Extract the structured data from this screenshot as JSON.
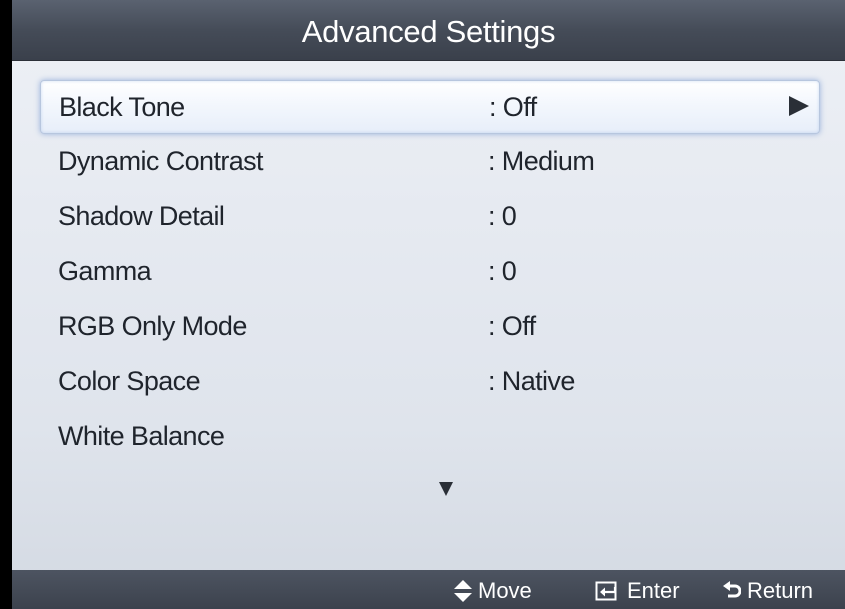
{
  "title": "Advanced Settings",
  "menu_items": [
    {
      "label": "Black Tone",
      "value": ": Off"
    },
    {
      "label": "Dynamic Contrast",
      "value": ": Medium"
    },
    {
      "label": "Shadow Detail",
      "value": ": 0"
    },
    {
      "label": "Gamma",
      "value": ": 0"
    },
    {
      "label": "RGB Only Mode",
      "value": ": Off"
    },
    {
      "label": "Color Space",
      "value": ": Native"
    },
    {
      "label": "White Balance",
      "value": ""
    }
  ],
  "selected_index": 0,
  "footer": {
    "move_label": "Move",
    "enter_label": "Enter",
    "return_label": "Return"
  },
  "icons": {
    "submenu": "arrow-right-icon",
    "scroll": "scroll-down-icon",
    "move": "up-down-arrow-icon",
    "enter": "enter-icon",
    "return": "return-icon"
  }
}
